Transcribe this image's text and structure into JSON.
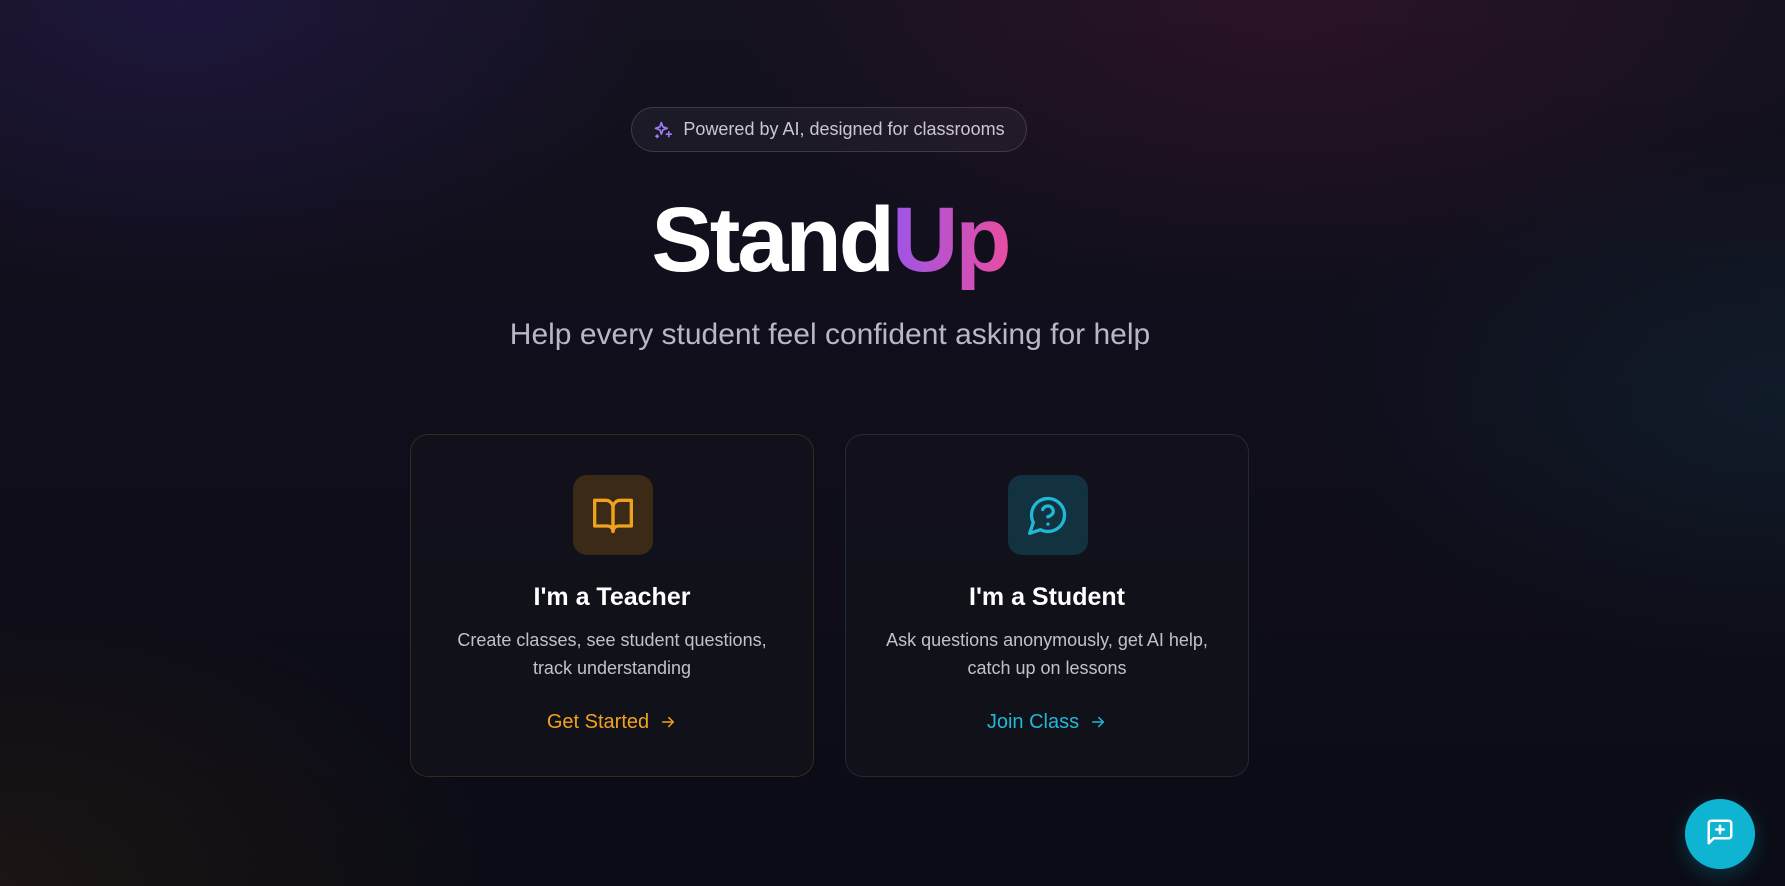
{
  "badge": {
    "text": "Powered by AI, designed for classrooms",
    "icon": "sparkles-icon"
  },
  "hero": {
    "title_part1": "Stand",
    "title_part2": "Up",
    "subtitle": "Help every student feel confident asking for help"
  },
  "cards": {
    "teacher": {
      "icon": "book-open-icon",
      "title": "I'm a Teacher",
      "description": "Create classes, see student questions, track understanding",
      "link": "Get Started",
      "link_icon": "arrow-right-icon",
      "accent": "#f0a21e"
    },
    "student": {
      "icon": "message-question-icon",
      "title": "I'm a Student",
      "description": "Ask questions anonymously, get AI help, catch up on lessons",
      "link": "Join Class",
      "link_icon": "arrow-right-icon",
      "accent": "#20b8d6"
    }
  },
  "fab": {
    "icon": "message-plus-icon",
    "color": "#0fb4d2"
  },
  "colors": {
    "title_gradient_start": "#9d55e8",
    "title_gradient_end": "#e84ea0"
  }
}
